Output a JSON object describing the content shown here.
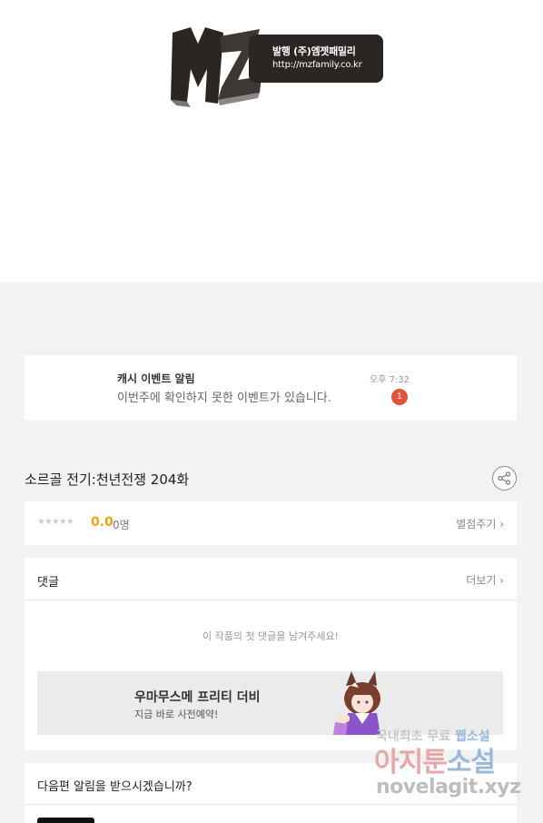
{
  "logo": {
    "line1": "발행 (주)엠젯패밀리",
    "line2": "http://mzfamily.co.kr"
  },
  "notification": {
    "title": "캐시 이벤트 알림",
    "message": "이번주에 확인하지 못한 이벤트가 있습니다.",
    "time": "오후 7:32",
    "badge": "1"
  },
  "episode": {
    "title": "소르골 전기:천년전쟁 204화"
  },
  "rating": {
    "stars": "★★★★★",
    "score": "0.0",
    "count": "0명",
    "action": "별점주기 ›",
    "score_color": "#f0a01e"
  },
  "comments": {
    "header": "댓글",
    "more": "더보기 ›",
    "empty": "이 작품의 첫 댓글을 남겨주세요!"
  },
  "ad": {
    "title": "우마무스메 프리티 더비",
    "subtitle": "지금 바로 사전예약!"
  },
  "next_alert": {
    "question": "다음편 알림을 받으시겠습니까?"
  },
  "watermark": {
    "line1_a": "국내최초 무료",
    "line1_b": "웹소설",
    "line2_a": "아지툰",
    "line2_b": "소설",
    "line3": "novelagit.xyz"
  }
}
